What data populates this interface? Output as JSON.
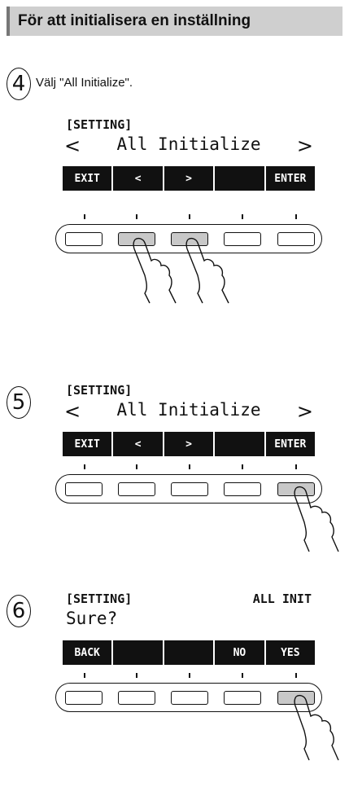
{
  "heading": "För att initialisera en inställning",
  "steps": [
    {
      "number": "4",
      "instruction": "Välj \"All Initialize\".",
      "lcd": {
        "line1_left": "[SETTING]",
        "line1_right": "",
        "line2": "All Initialize",
        "arrow_left": "<",
        "arrow_right": ">",
        "softkeys": [
          "EXIT",
          "<",
          ">",
          "",
          "ENTER"
        ]
      },
      "pressed_keys": [
        2,
        3
      ]
    },
    {
      "number": "5",
      "instruction": "",
      "lcd": {
        "line1_left": "[SETTING]",
        "line1_right": "",
        "line2": "All Initialize",
        "arrow_left": "<",
        "arrow_right": ">",
        "softkeys": [
          "EXIT",
          "<",
          ">",
          "",
          "ENTER"
        ]
      },
      "pressed_keys": [
        5
      ]
    },
    {
      "number": "6",
      "instruction": "",
      "lcd": {
        "line1_left": "[SETTING]",
        "line1_right": "ALL INIT",
        "line2": "Sure?",
        "arrow_left": "",
        "arrow_right": "",
        "softkeys": [
          "BACK",
          "",
          "",
          "NO",
          "YES"
        ]
      },
      "pressed_keys": [
        5
      ]
    }
  ],
  "icons": [
    "finger-pointer-icon"
  ]
}
